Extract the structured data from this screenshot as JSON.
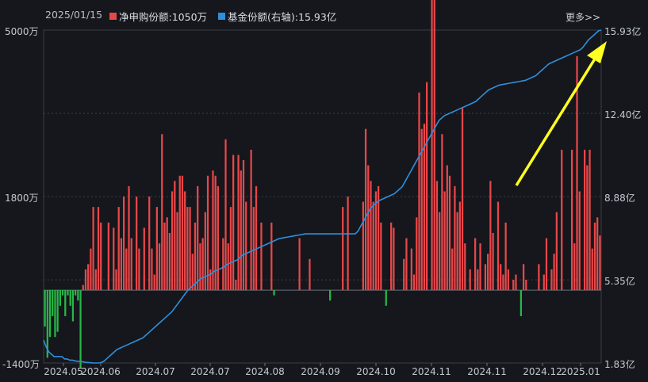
{
  "header": {
    "date": "2025/01/15",
    "legend": [
      {
        "label": "净申购份额:1050万",
        "color": "#e8474a"
      },
      {
        "label": "基金份额(右轴):15.93亿",
        "color": "#2f8fdc"
      }
    ],
    "more": "更多>>"
  },
  "colors": {
    "up": "#e8474a",
    "down": "#27b748",
    "line": "#2f8fdc",
    "arrow": "#ffff22",
    "grid": "#3a3e46"
  },
  "chart_data": {
    "type": "bar+line",
    "left_axis": {
      "min": -1400,
      "max": 5000,
      "ticks": [
        "5000万",
        "1800万",
        "-1400万"
      ]
    },
    "right_axis": {
      "min": 1.83,
      "max": 15.93,
      "ticks": [
        "15.93亿",
        "12.40亿",
        "8.88亿",
        "5.35亿",
        "1.83亿"
      ]
    },
    "x_ticks": [
      "2024.05",
      "2024.06",
      "2024.07",
      "2024.07",
      "2024.08",
      "2024.09",
      "2024.10",
      "2024.11",
      "2024.11",
      "2024.12",
      "2025.01"
    ],
    "bars": [
      -700,
      -1300,
      -900,
      -500,
      -900,
      -800,
      -300,
      -100,
      -500,
      -100,
      -300,
      -600,
      -100,
      -200,
      -1500,
      100,
      400,
      500,
      800,
      1600,
      400,
      1600,
      1300,
      0,
      0,
      1300,
      0,
      1200,
      400,
      1600,
      1000,
      1800,
      800,
      2000,
      1000,
      0,
      1800,
      800,
      0,
      1200,
      0,
      1800,
      800,
      300,
      1600,
      900,
      3000,
      1300,
      1400,
      1100,
      1900,
      2100,
      1500,
      2200,
      2200,
      1900,
      1600,
      1600,
      700,
      1300,
      2000,
      900,
      1000,
      1500,
      2200,
      400,
      2300,
      2200,
      2000,
      0,
      1000,
      2900,
      900,
      1600,
      2600,
      200,
      2600,
      2300,
      2500,
      1700,
      0,
      2700,
      1600,
      2000,
      0,
      1300,
      0,
      0,
      0,
      1300,
      -100,
      0,
      0,
      0,
      0,
      0,
      0,
      0,
      0,
      0,
      1000,
      0,
      0,
      0,
      600,
      0,
      0,
      0,
      0,
      0,
      0,
      0,
      -200,
      0,
      0,
      0,
      0,
      1600,
      0,
      1800,
      0,
      0,
      0,
      0,
      0,
      1700,
      3100,
      2400,
      2100,
      1700,
      1900,
      2000,
      1300,
      0,
      -300,
      0,
      1300,
      1200,
      0,
      0,
      0,
      600,
      1000,
      0,
      800,
      300,
      1400,
      3800,
      3100,
      3200,
      4000,
      0,
      6300,
      5800,
      2100,
      1500,
      3000,
      1900,
      2400,
      2200,
      800,
      2000,
      1500,
      1700,
      3500,
      900,
      0,
      400,
      0,
      1000,
      400,
      900,
      0,
      500,
      700,
      2100,
      1100,
      0,
      1700,
      500,
      300,
      1300,
      400,
      0,
      200,
      300,
      0,
      -500,
      500,
      200,
      0,
      0,
      0,
      0,
      500,
      0,
      300,
      1000,
      0,
      400,
      700,
      1500,
      0,
      2700,
      0,
      0,
      0,
      2700,
      900,
      4500,
      1900,
      0,
      2700,
      2400,
      2700,
      800,
      1300,
      1400,
      1050
    ],
    "line": [
      2.8,
      2.5,
      2.3,
      2.2,
      2.1,
      2.1,
      2.1,
      2.1,
      2.0,
      2.0,
      1.95,
      1.95,
      1.92,
      1.9,
      1.9,
      1.88,
      1.86,
      1.85,
      1.84,
      1.83,
      1.83,
      1.83,
      1.85,
      1.9,
      2.0,
      2.1,
      2.2,
      2.3,
      2.4,
      2.45,
      2.5,
      2.55,
      2.6,
      2.65,
      2.7,
      2.75,
      2.8,
      2.85,
      2.9,
      3.0,
      3.1,
      3.2,
      3.3,
      3.4,
      3.5,
      3.6,
      3.7,
      3.8,
      3.9,
      4.0,
      4.15,
      4.3,
      4.45,
      4.6,
      4.75,
      4.9,
      5.0,
      5.1,
      5.2,
      5.3,
      5.4,
      5.45,
      5.5,
      5.55,
      5.6,
      5.7,
      5.75,
      5.8,
      5.85,
      5.9,
      6.0,
      6.05,
      6.1,
      6.15,
      6.2,
      6.3,
      6.4,
      6.45,
      6.5,
      6.55,
      6.6,
      6.65,
      6.7,
      6.75,
      6.8,
      6.85,
      6.9,
      6.95,
      7.0,
      7.05,
      7.1,
      7.12,
      7.14,
      7.16,
      7.18,
      7.2,
      7.22,
      7.24,
      7.26,
      7.28,
      7.3,
      7.3,
      7.3,
      7.3,
      7.3,
      7.3,
      7.3,
      7.3,
      7.3,
      7.3,
      7.3,
      7.3,
      7.3,
      7.3,
      7.3,
      7.3,
      7.3,
      7.3,
      7.3,
      7.3,
      7.4,
      7.6,
      7.8,
      8.0,
      8.2,
      8.4,
      8.5,
      8.6,
      8.7,
      8.75,
      8.8,
      8.85,
      8.9,
      8.95,
      9.0,
      9.1,
      9.2,
      9.3,
      9.5,
      9.7,
      9.9,
      10.1,
      10.3,
      10.5,
      10.7,
      10.9,
      11.1,
      11.3,
      11.5,
      11.7,
      11.9,
      12.1,
      12.2,
      12.3,
      12.35,
      12.4,
      12.45,
      12.5,
      12.55,
      12.6,
      12.65,
      12.7,
      12.75,
      12.8,
      12.85,
      12.9,
      13.0,
      13.1,
      13.2,
      13.3,
      13.4,
      13.45,
      13.5,
      13.55,
      13.6,
      13.62,
      13.64,
      13.66,
      13.68,
      13.7,
      13.72,
      13.74,
      13.76,
      13.78,
      13.8,
      13.85,
      13.9,
      13.95,
      14.0,
      14.1,
      14.2,
      14.3,
      14.4,
      14.5,
      14.55,
      14.6,
      14.65,
      14.7,
      14.75,
      14.8,
      14.85,
      14.9,
      14.95,
      15.0,
      15.05,
      15.1,
      15.2,
      15.35,
      15.5,
      15.6,
      15.7,
      15.8,
      15.9,
      15.93
    ]
  }
}
